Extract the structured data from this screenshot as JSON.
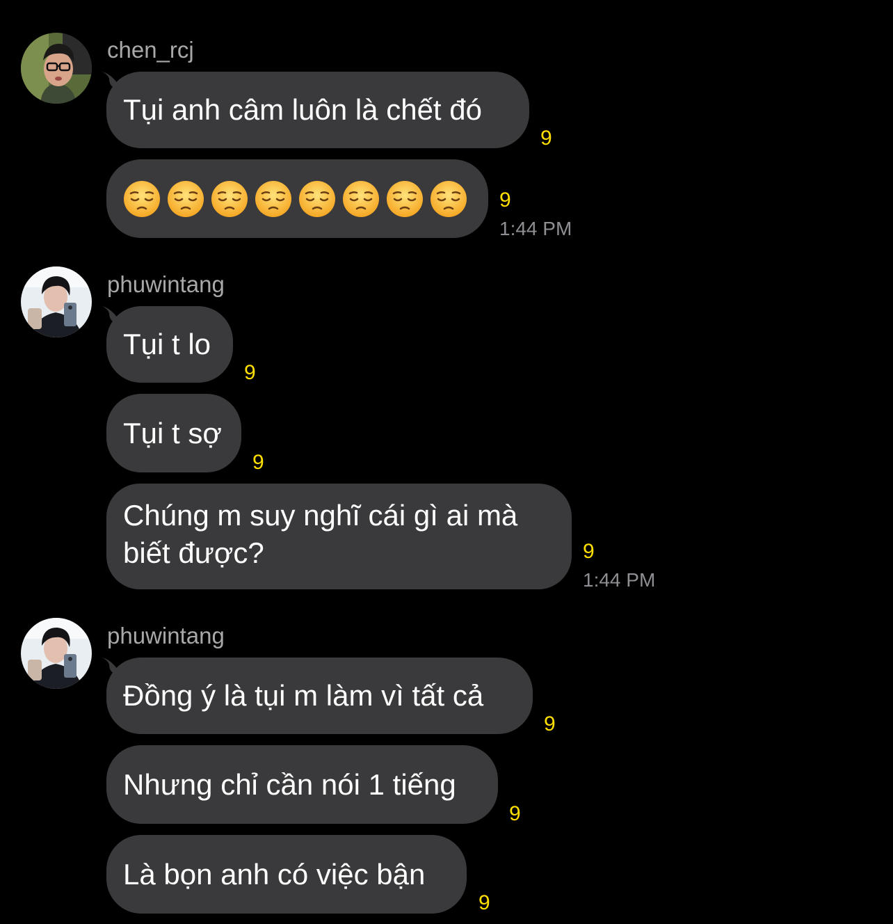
{
  "groups": [
    {
      "username": "chen_rcj",
      "messages": [
        {
          "text": "Tụi anh câm luôn là chết đó",
          "badge": "9"
        },
        {
          "emojis": [
            "pensive-face",
            "pensive-face",
            "pensive-face",
            "pensive-face",
            "pensive-face",
            "pensive-face",
            "pensive-face",
            "pensive-face"
          ],
          "badge": "9",
          "time": "1:44 PM"
        }
      ]
    },
    {
      "username": "phuwintang",
      "messages": [
        {
          "text": "Tụi t lo",
          "badge": "9"
        },
        {
          "text": "Tụi t sợ",
          "badge": "9"
        },
        {
          "text": "Chúng m suy nghĩ cái gì ai mà biết được?",
          "badge": "9",
          "time": "1:44 PM"
        }
      ]
    },
    {
      "username": "phuwintang",
      "messages": [
        {
          "text": "Đồng ý là tụi m làm vì tất cả",
          "badge": "9"
        },
        {
          "text": "Nhưng chỉ cần nói 1 tiếng",
          "badge": "9"
        },
        {
          "text": "Là bọn anh có việc bận",
          "badge": "9"
        }
      ]
    }
  ],
  "colors": {
    "background": "#000000",
    "bubble": "#3a3a3c",
    "badge": "#ffdf00",
    "username": "#a8a8a8",
    "timestamp": "#8e8e93"
  }
}
